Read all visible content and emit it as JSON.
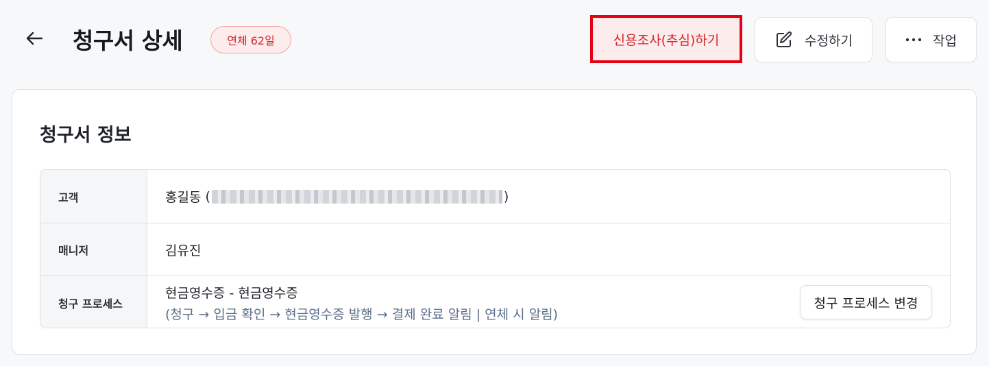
{
  "header": {
    "title": "청구서 상세",
    "badge": "연체 62일",
    "actions": {
      "credit_check": "신용조사(추심)하기",
      "edit": "수정하기",
      "more": "작업"
    }
  },
  "invoice_info": {
    "title": "청구서 정보",
    "rows": {
      "customer": {
        "label": "고객",
        "name": "홍길동",
        "open_paren": "(",
        "close_paren": ")"
      },
      "manager": {
        "label": "매니저",
        "value": "김유진"
      },
      "process": {
        "label": "청구 프로세스",
        "main": "현금영수증 - 현금영수증",
        "flow": "(청구 → 입금 확인 → 현금영수증 발행 → 결제 완료 알림  |  연체 시 알림)",
        "change_button": "청구 프로세스 변경"
      }
    }
  },
  "colors": {
    "accent_red": "#d3262b",
    "highlight_border": "#e60012",
    "flow_text": "#5c6f8a"
  },
  "icons": [
    "arrow-left-icon",
    "pencil-icon",
    "ellipsis-icon"
  ]
}
